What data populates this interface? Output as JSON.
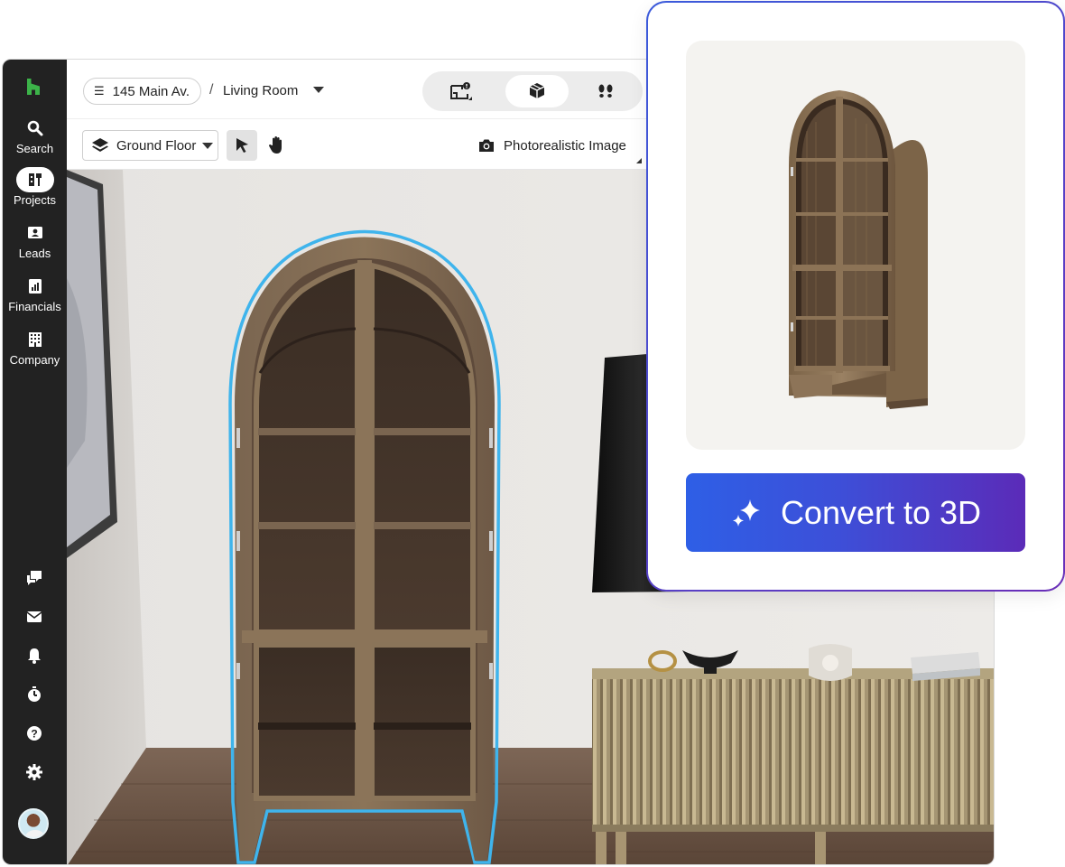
{
  "sidebar": {
    "items": [
      {
        "label": "Search",
        "icon": "search-icon"
      },
      {
        "label": "Projects",
        "icon": "projects-icon",
        "active": true
      },
      {
        "label": "Leads",
        "icon": "leads-icon"
      },
      {
        "label": "Financials",
        "icon": "financials-icon"
      },
      {
        "label": "Company",
        "icon": "company-icon"
      }
    ],
    "bottom_icons": [
      "chat-icon",
      "inbox-icon",
      "bell-icon",
      "timer-icon",
      "help-icon",
      "settings-icon"
    ]
  },
  "header": {
    "project": "145 Main Av.",
    "separator": "/",
    "room": "Living Room",
    "view_modes": [
      "floor-plan-icon",
      "3d-box-icon",
      "walkthrough-icon"
    ],
    "active_view": "3d-box-icon"
  },
  "toolbar": {
    "floor_label": "Ground Floor",
    "render_label": "Photorealistic Image"
  },
  "card": {
    "button_label": "Convert to 3D"
  },
  "colors": {
    "sidebar_bg": "#222222",
    "brand_green": "#3cb349",
    "selection_outline": "#3fb4ec",
    "button_gradient_start": "#2e5fe6",
    "button_gradient_end": "#5b2bb8"
  }
}
